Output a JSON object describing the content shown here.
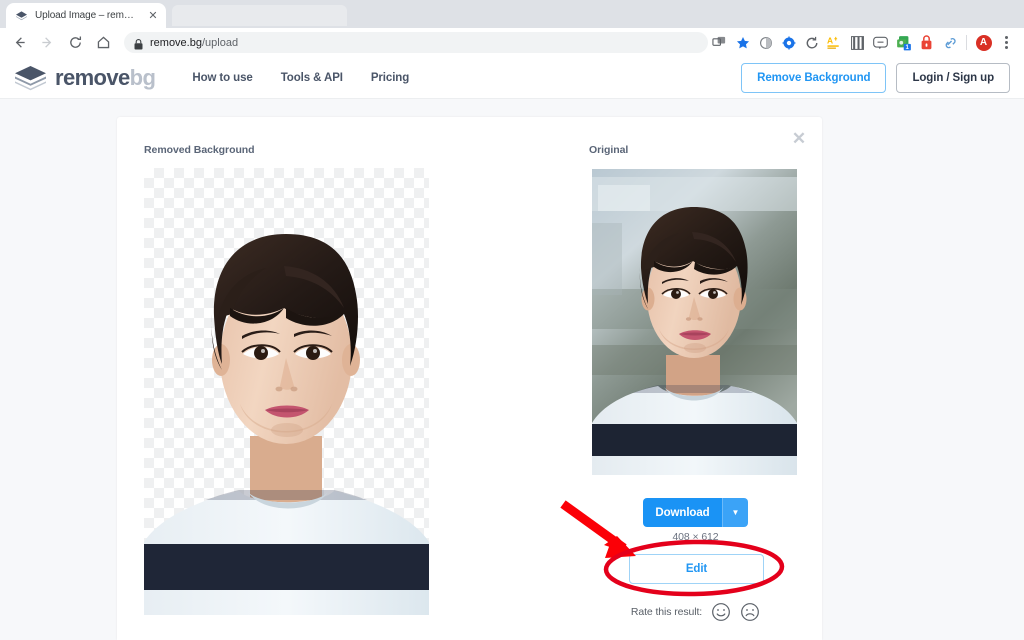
{
  "browser": {
    "tab": {
      "title": "Upload Image – remove.bg",
      "favicon_icon": "removebg-logo-icon",
      "close_icon": "close-icon"
    },
    "nav": {
      "back_icon": "arrow-left-icon",
      "forward_icon": "arrow-right-icon",
      "reload_icon": "reload-icon",
      "home_icon": "home-icon"
    },
    "omnibox": {
      "lock_icon": "lock-icon",
      "url_domain": "remove.bg",
      "url_path": "/upload"
    },
    "extensions": [
      {
        "name": "screenshot-extension-icon",
        "color": "#5f6368"
      },
      {
        "name": "bookmark-star-icon",
        "color": "#1a73e8"
      },
      {
        "name": "circle-gray-extension-icon",
        "color": "#808080"
      },
      {
        "name": "blue-target-extension-icon",
        "color": "#1a73e8"
      },
      {
        "name": "refresh-extension-icon",
        "color": "#5f6368"
      },
      {
        "name": "translate-extension-icon",
        "color": "#fbbc04"
      },
      {
        "name": "columns-extension-icon",
        "color": "#5f6368"
      },
      {
        "name": "chat-bubble-extension-icon",
        "color": "#5f6368"
      },
      {
        "name": "green-badge-extension-icon",
        "color": "#34a853",
        "badge": "1"
      },
      {
        "name": "red-lock-extension-icon",
        "color": "#ea4335"
      },
      {
        "name": "link-extension-icon",
        "color": "#4a90d9"
      }
    ],
    "profile": {
      "name": "profile-avatar",
      "initial": "A",
      "color": "#d93025"
    },
    "menu_icon": "kebab-menu-icon"
  },
  "site": {
    "logo": {
      "icon": "removebg-layers-icon",
      "text_dark": "remove",
      "text_light": "bg"
    },
    "nav_links": [
      {
        "label": "How to use"
      },
      {
        "label": "Tools & API"
      },
      {
        "label": "Pricing"
      }
    ],
    "remove_bg_button": "Remove Background",
    "login_button": "Login / Sign up"
  },
  "card": {
    "close_icon": "close-icon",
    "left_panel_label": "Removed Background",
    "right_panel_label": "Original",
    "download_button": "Download",
    "download_caret_icon": "chevron-down-icon",
    "dimensions": "408 × 612",
    "edit_button": "Edit",
    "rate_label": "Rate this result:",
    "rate_positive_icon": "smiley-happy-icon",
    "rate_negative_icon": "smiley-sad-icon"
  },
  "annotation": {
    "arrow_color": "#ff0000",
    "ellipse_color": "#ff0000",
    "arrow_name": "red-pointer-arrow",
    "ellipse_name": "red-highlight-ellipse"
  },
  "colors": {
    "accent_blue": "#1a93f5",
    "link_blue": "#2196f3",
    "page_bg": "#f7f8fa",
    "logo_dark": "#4a5568",
    "logo_light": "#b9c0cb",
    "annotation_red": "#ff0000"
  }
}
